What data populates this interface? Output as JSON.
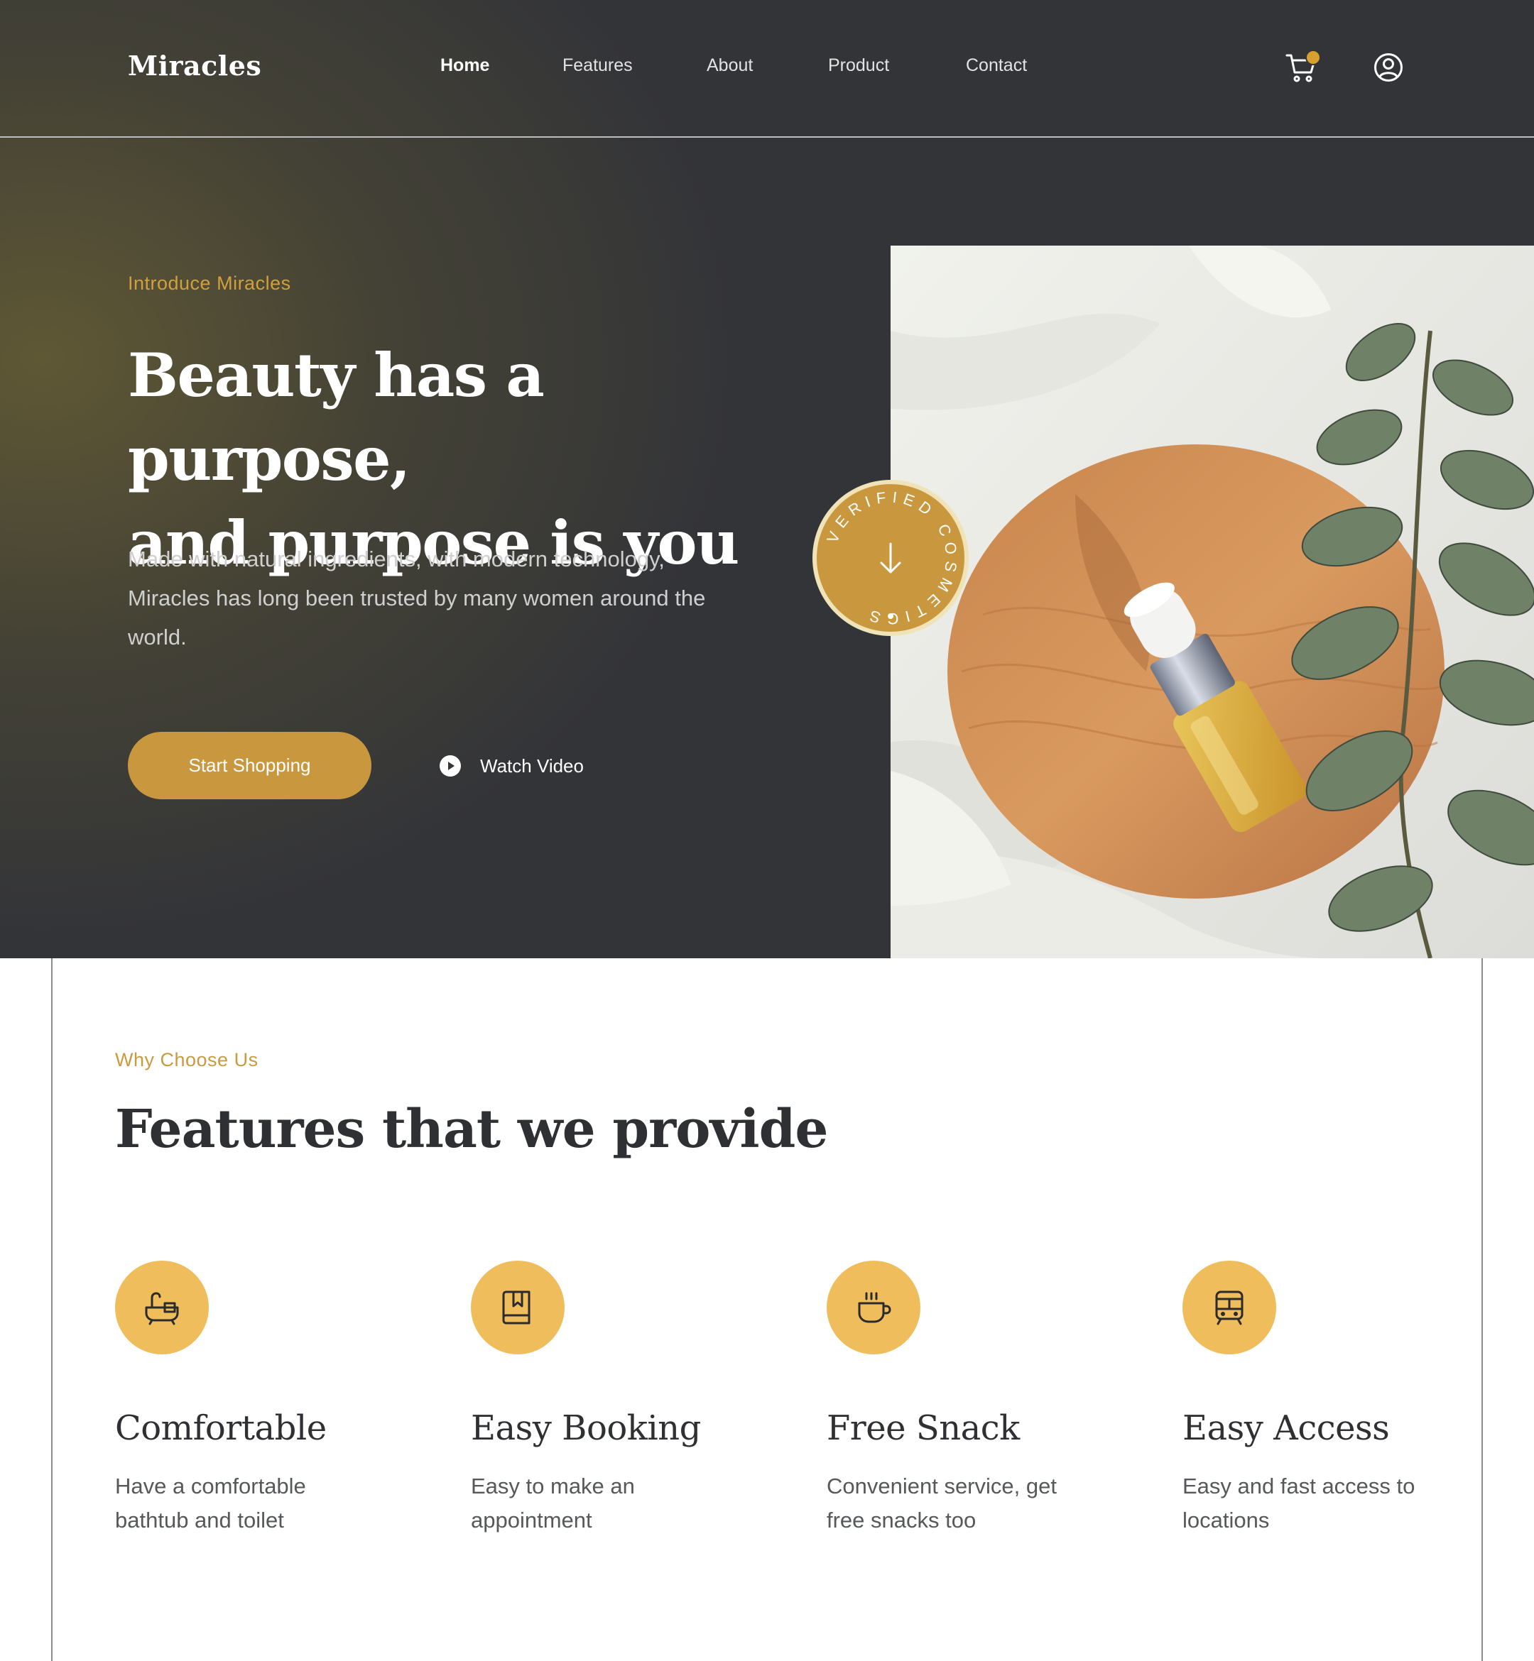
{
  "brand": "Miracles",
  "nav": {
    "items": [
      "Home",
      "Features",
      "About",
      "Product",
      "Contact"
    ],
    "active_index": 0
  },
  "hero": {
    "eyebrow": "Introduce Miracles",
    "title_line1": "Beauty has a purpose,",
    "title_line2": "and purpose is you",
    "description": "Made with natural ingredients, with modern technology, Miracles has long been trusted by many women around the world.",
    "primary_button": "Start Shopping",
    "secondary_button": "Watch Video",
    "badge_text": "VERIFIED COSMETICS"
  },
  "features": {
    "eyebrow": "Why Choose Us",
    "title": "Features that we provide",
    "cards": [
      {
        "icon": "bathtub-icon",
        "title": "Comfortable",
        "description": "Have a comfortable bathtub and toilet"
      },
      {
        "icon": "book-icon",
        "title": "Easy Booking",
        "description": "Easy to make an appointment"
      },
      {
        "icon": "coffee-cup-icon",
        "title": "Free Snack",
        "description": "Convenient service, get free snacks too"
      },
      {
        "icon": "train-icon",
        "title": "Easy Access",
        "description": "Easy and fast access to locations"
      }
    ]
  },
  "colors": {
    "hero_background": "#333438",
    "accent_gold": "#c9983e",
    "icon_circle": "#f0bd5c",
    "heading_dark": "#2f3033"
  }
}
